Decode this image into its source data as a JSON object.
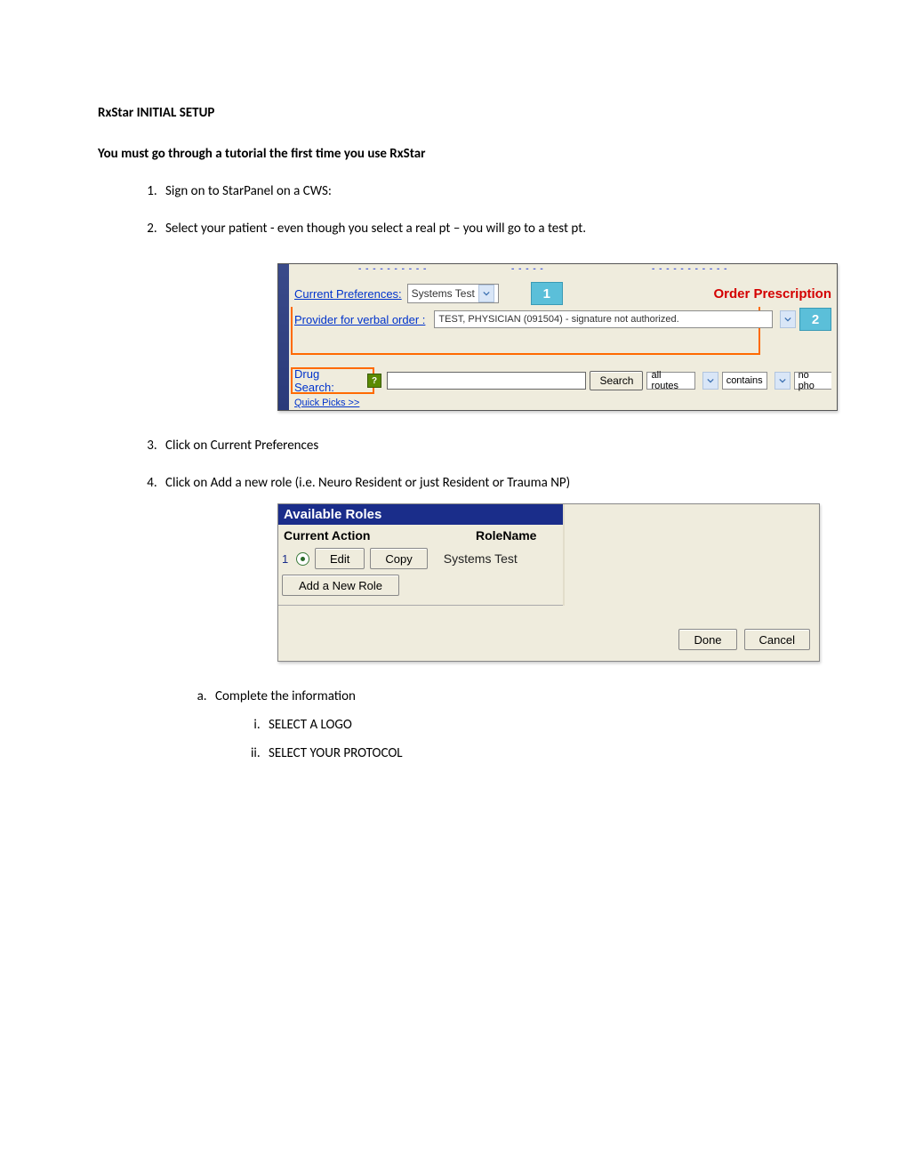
{
  "doc": {
    "title": "RxStar INITIAL SETUP",
    "subtitle": "You must go through a tutorial the first time you use RxStar",
    "steps": {
      "s1": "Sign on to StarPanel on a CWS:",
      "s2": "Select your patient - even though you select a real pt – you will go to a test pt.",
      "s3": "Click on Current Preferences",
      "s4": "Click on Add a new role (i.e. Neuro Resident or just Resident or Trauma NP)",
      "s4a": "Complete the information",
      "s4ai": "SELECT A LOGO",
      "s4aii": "SELECT YOUR PROTOCOL"
    }
  },
  "shot1": {
    "pref_label": "Current Preferences:",
    "pref_value": "Systems Test",
    "callout1": "1",
    "order_rx": "Order Prescription",
    "provider_label": "Provider for verbal order :",
    "provider_value": "TEST, PHYSICIAN (091504) - signature not authorized.",
    "callout2": "2",
    "drug_label": "Drug Search:",
    "search_btn": "Search",
    "routes": "all routes",
    "contains": "contains",
    "nopho": "no pho",
    "quick": "Quick Picks >>"
  },
  "shot2": {
    "header": "Available Roles",
    "col1": "Current Action",
    "col2": "RoleName",
    "rownum": "1",
    "edit": "Edit",
    "copy": "Copy",
    "rolename": "Systems Test",
    "add": "Add a New Role",
    "done": "Done",
    "cancel": "Cancel"
  }
}
